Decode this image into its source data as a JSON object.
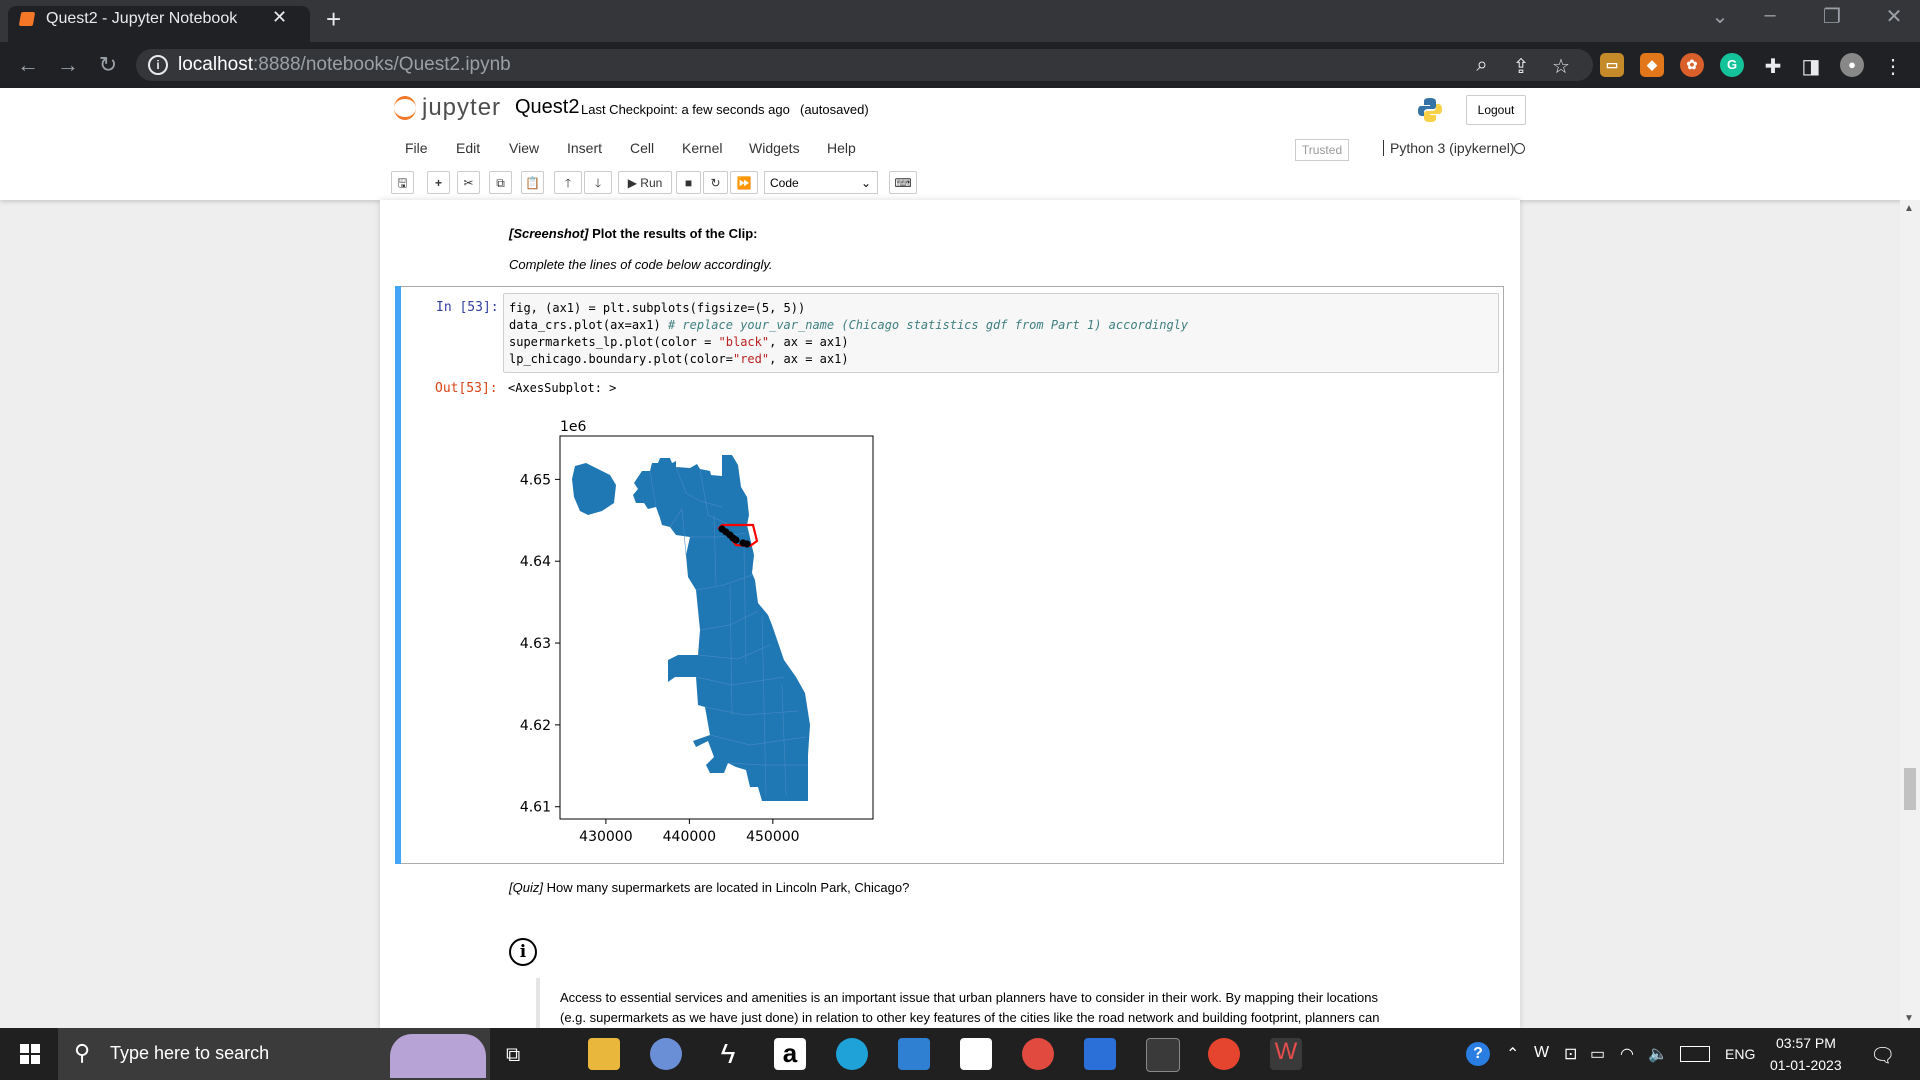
{
  "browser": {
    "tab_title": "Quest2 - Jupyter Notebook",
    "url_host": "localhost",
    "url_path": ":8888/notebooks/Quest2.ipynb"
  },
  "jupyter": {
    "logo_text": "jupyter",
    "notebook_name": "Quest2",
    "checkpoint": "Last Checkpoint: a few seconds ago",
    "autosave": "(autosaved)",
    "logout_label": "Logout",
    "menu": [
      "File",
      "Edit",
      "View",
      "Insert",
      "Cell",
      "Kernel",
      "Widgets",
      "Help"
    ],
    "trusted": "Trusted",
    "kernel": "Python 3 (ipykernel)",
    "toolbar": {
      "run_label": "Run",
      "cell_type": "Code"
    }
  },
  "notebook": {
    "md1_bracket": "[Screenshot]",
    "md1_text": " Plot the results of the Clip:",
    "md2": "Complete the lines of code below accordingly.",
    "in_prompt": "In [53]:",
    "out_prompt": "Out[53]:",
    "code": {
      "line1": "fig, (ax1) = plt.subplots(figsize=(5, 5))",
      "line2_code": "data_crs.plot(ax=ax1) ",
      "line2_comment": "# replace your_var_name (Chicago statistics gdf from Part 1) accordingly",
      "line3a": "supermarkets_lp.plot(color = ",
      "line3b": "\"black\"",
      "line3c": ", ax = ax1)",
      "line4a": "lp_chicago.boundary.plot(color=",
      "line4b": "\"red\"",
      "line4c": ", ax = ax1)"
    },
    "output_text": "<AxesSubplot: >",
    "quiz_bracket": "[Quiz]",
    "quiz_text": " How many supermarkets are located in Lincoln Park, Chicago?",
    "info_paragraph_line1": "Access to essential services and amenities is an important issue that urban planners have to consider in their work. By mapping their locations",
    "info_paragraph_line2": "(e.g. supermarkets as we have just done) in relation to other key features of the cities like the road network and building footprint, planners can"
  },
  "chart_data": {
    "type": "map",
    "offset_label": "1e6",
    "x_ticks": [
      430000,
      440000,
      450000
    ],
    "x_tick_labels": [
      "430000",
      "440000",
      "450000"
    ],
    "y_ticks": [
      4.61,
      4.62,
      4.63,
      4.64,
      4.65
    ],
    "y_tick_labels": [
      "4.61",
      "4.62",
      "4.63",
      "4.64",
      "4.65"
    ],
    "xlim": [
      424500,
      462000
    ],
    "ylim": [
      4.6085,
      4.6553
    ],
    "layers": [
      {
        "name": "data_crs",
        "color": "#1f77b4"
      },
      {
        "name": "supermarkets_lp",
        "color": "#000000"
      },
      {
        "name": "lp_chicago.boundary",
        "color": "#ff0000"
      }
    ]
  },
  "taskbar": {
    "search_placeholder": "Type here to search",
    "language": "ENG",
    "time": "03:57 PM",
    "date": "01-01-2023"
  }
}
